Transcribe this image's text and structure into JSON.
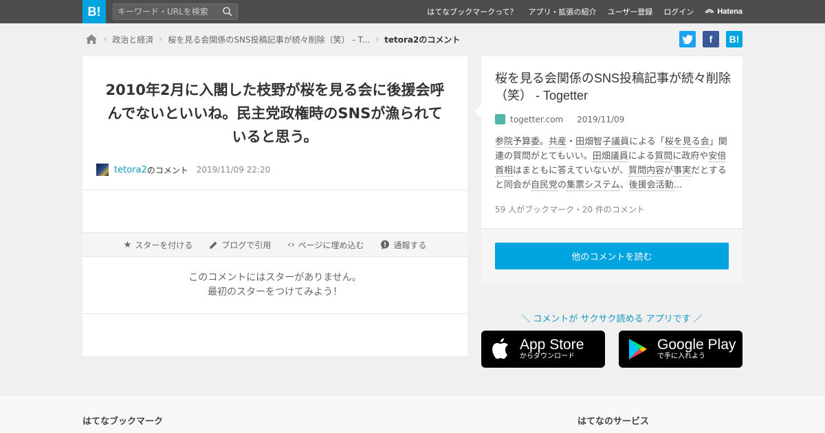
{
  "header": {
    "logo": "B!",
    "search_placeholder": "キーワード・URLを検索",
    "nav": [
      "はてなブックマークって？",
      "アプリ・拡張の紹介",
      "ユーザー登録",
      "ログイン"
    ],
    "brand": "Hatena"
  },
  "breadcrumb": {
    "items": [
      "政治と経済",
      "桜を見る会関係のSNS投稿記事が続々削除（笑） - T..."
    ],
    "current": "tetora2のコメント"
  },
  "share": {
    "twitter": "t",
    "facebook": "f",
    "hatena": "B!"
  },
  "comment": {
    "text": "2010年2月に入閣した枝野が桜を見る会に後援会呼んでないといいね。民主党政権時のSNSが漁られていると思う。",
    "user": "tetora2",
    "user_suffix": "のコメント",
    "date": "2019/11/09 22:20"
  },
  "actions": {
    "star": "スターを付ける",
    "blog": "ブログで引用",
    "embed": "ページに埋め込む",
    "report": "通報する"
  },
  "nostar": {
    "line1": "このコメントにはスターがありません。",
    "line2": "最初のスターをつけてみよう！"
  },
  "entry": {
    "title": "桜を見る会関係のSNS投稿記事が続々削除（笑） - Togetter",
    "domain": "togetter.com",
    "date": "2019/11/09",
    "summary": {
      "k1": "参院予算委",
      "t1": "。",
      "k2": "共産",
      "t2": "・",
      "k3": "田畑智子議員",
      "t3": "による「",
      "k4": "桜を見る会",
      "t4": "」関連の質問がとてもいい。",
      "k5": "田畑議員",
      "t5": "による",
      "k6": "質問",
      "t6": "に政府や",
      "k7": "安倍首相",
      "t7": "はまともに答えていないが、",
      "k8": "質問内容",
      "t8": "が",
      "k9": "事実",
      "t9": "だとすると同会が",
      "k10": "自民党",
      "t10": "の",
      "k11": "集票システム",
      "t11": "、",
      "k12": "後援会活動",
      "t12": "..."
    },
    "counts": "59 人がブックマーク・20 件のコメント",
    "read_button": "他のコメントを読む"
  },
  "app": {
    "promo": "＼ コメントが サクサク読める アプリです ／",
    "apple_title": "App Store",
    "apple_sub": "からダウンロード",
    "google_title": "Google Play",
    "google_sub": "で手に入れよう"
  },
  "footer": {
    "left": "はてなブックマーク",
    "right": "はてなのサービス"
  },
  "colors": {
    "accent": "#00a4de",
    "topbar": "#4d4d4d",
    "link": "#1295c0"
  }
}
